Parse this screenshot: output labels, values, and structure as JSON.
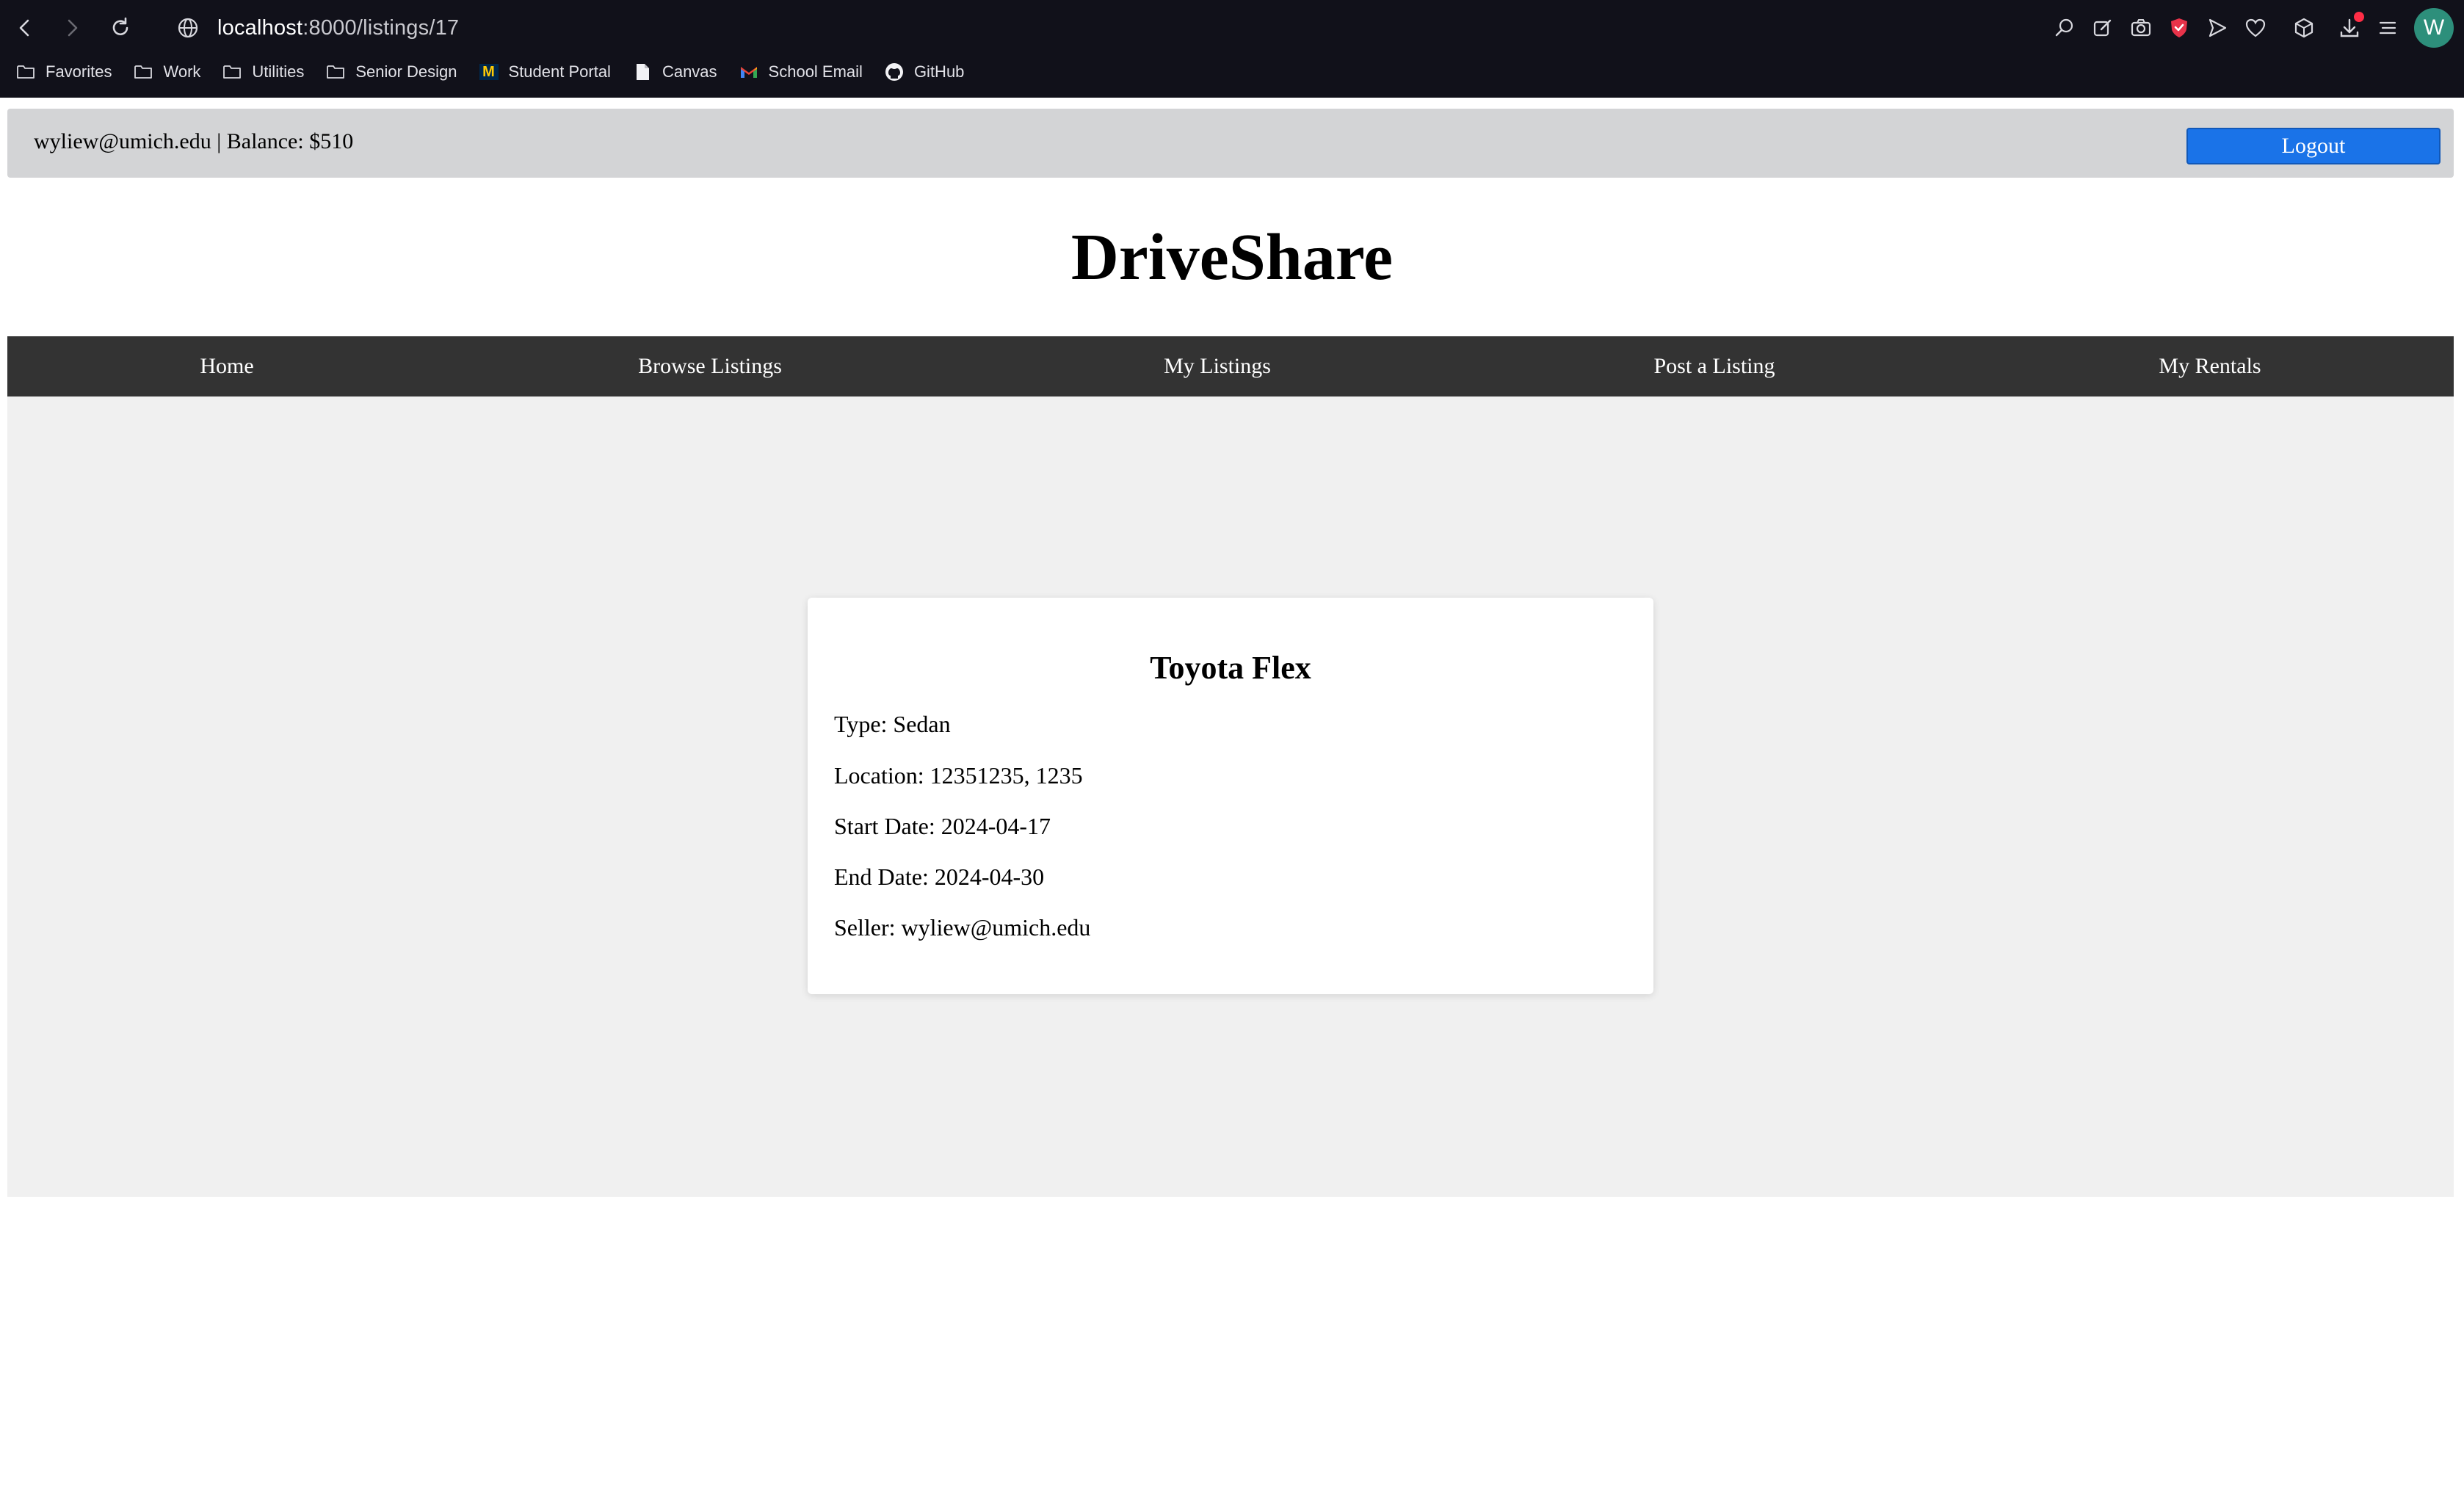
{
  "browser": {
    "url_host": "localhost",
    "url_path": ":8000/listings/17",
    "bookmarks": [
      {
        "label": "Favorites",
        "icon": "folder-icon"
      },
      {
        "label": "Work",
        "icon": "folder-icon"
      },
      {
        "label": "Utilities",
        "icon": "folder-icon"
      },
      {
        "label": "Senior Design",
        "icon": "folder-icon"
      },
      {
        "label": "Student Portal",
        "icon": "umich-m-icon"
      },
      {
        "label": "Canvas",
        "icon": "document-icon"
      },
      {
        "label": "School Email",
        "icon": "gmail-icon"
      },
      {
        "label": "GitHub",
        "icon": "github-icon"
      }
    ],
    "avatar_initial": "W"
  },
  "header": {
    "user_info": "wyliew@umich.edu | Balance: $510",
    "logout_label": "Logout"
  },
  "site_title": "DriveShare",
  "nav": {
    "items": [
      "Home",
      "Browse Listings",
      "My Listings",
      "Post a Listing",
      "My Rentals"
    ]
  },
  "listing": {
    "title": "Toyota Flex",
    "type": "Type: Sedan",
    "location": "Location: 12351235, 1235",
    "start_date": "Start Date: 2024-04-17",
    "end_date": "End Date: 2024-04-30",
    "seller": "Seller: wyliew@umich.edu"
  },
  "colors": {
    "logout_button": "#1a73e8",
    "nav_bar": "#333333",
    "user_bar": "#d3d4d6"
  }
}
